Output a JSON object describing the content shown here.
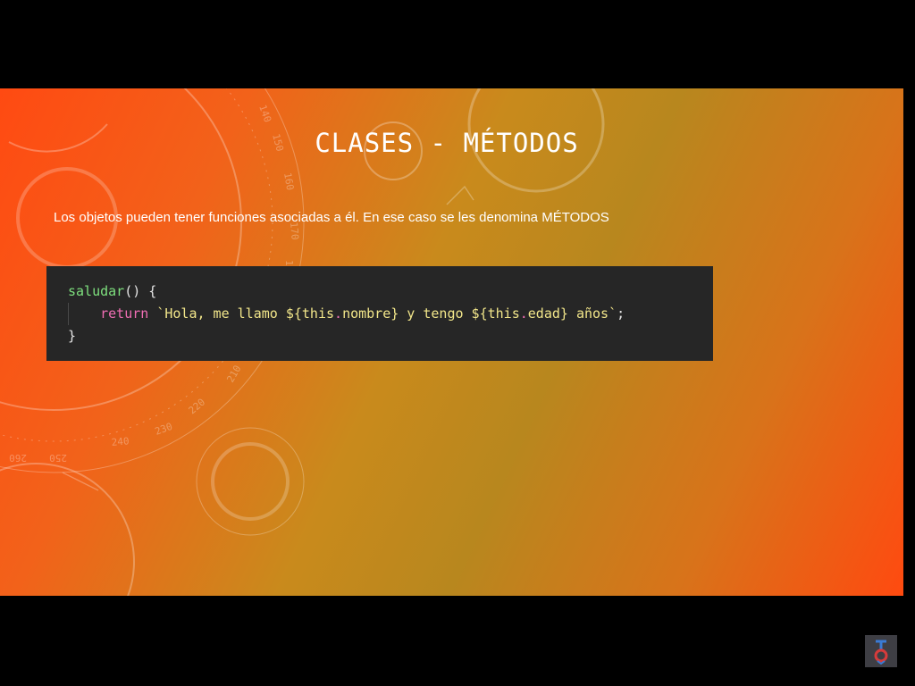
{
  "slide": {
    "title": "CLASES - MÉTODOS",
    "body": "Los objetos pueden tener funciones asociadas a él. En ese caso se les denomina MÉTODOS",
    "code": {
      "line1": {
        "fn": "saludar",
        "rest": "() {"
      },
      "line2": {
        "keyword": "return",
        "str_start": "`Hola, me llamo ${",
        "this1": "this",
        "dot1": ".",
        "prop1": "nombre",
        "str_mid": "} y tengo ${",
        "this2": "this",
        "dot2": ".",
        "prop2": "edad",
        "str_end": "} años`",
        "semicolon": ";"
      },
      "line3": {
        "close": "}"
      }
    }
  },
  "colors": {
    "background_orange": "#ff4a12",
    "background_olive": "#b8871e",
    "code_background": "#262626",
    "function_green": "#7ee07e",
    "keyword_pink": "#f06eb4",
    "string_yellow": "#f2e68a"
  },
  "icons": {
    "watermark": "logo-icon"
  }
}
